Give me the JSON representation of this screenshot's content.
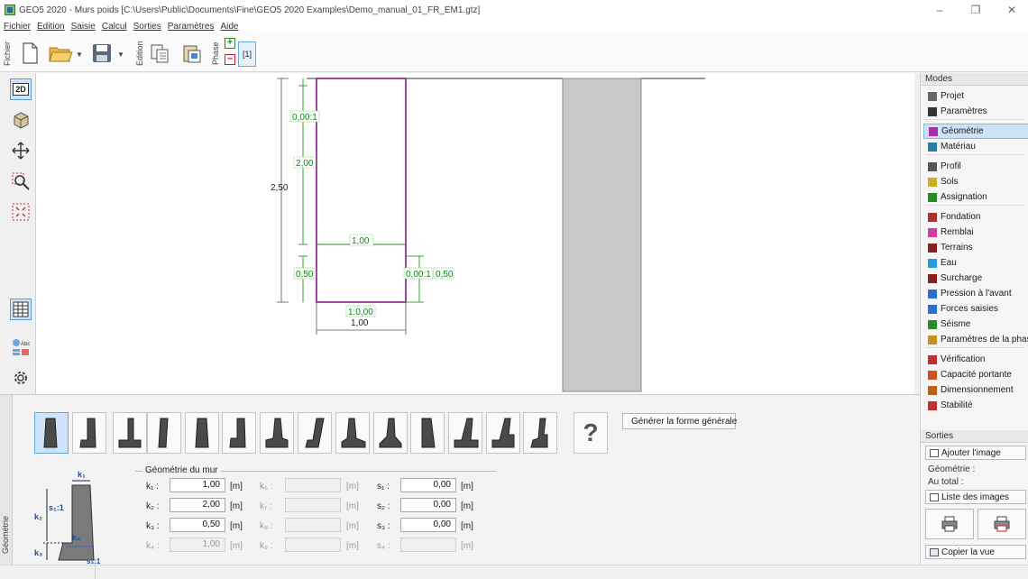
{
  "window": {
    "title": "GEO5 2020 - Murs poids [C:\\Users\\Public\\Documents\\Fine\\GEO5 2020 Examples\\Demo_manual_01_FR_EM1.gtz]",
    "minimize": "–",
    "maximize": "❐",
    "close": "✕"
  },
  "menu": [
    "Fichier",
    "Edition",
    "Saisie",
    "Calcul",
    "Sorties",
    "Paramètres",
    "Aide"
  ],
  "toolbar": {
    "fichier_label": "Fichier",
    "edition_label": "Edition",
    "phase_label": "Phase",
    "phase_tab": "[1]",
    "add_phase": "+",
    "remove_phase": "–"
  },
  "lefttools": {
    "btn_2d": "2D",
    "btn_3d": "3D"
  },
  "canvas": {
    "dims": {
      "top_slope": "0,00:1",
      "height_k2": "2,00",
      "height_total": "2,50",
      "width_k1": "1,00",
      "height_k3": "0,50",
      "toe_slope": "0,00:1",
      "height_k3_right": "0,50",
      "base_slope": "1:0,00",
      "base_width": "1,00"
    },
    "colors": {
      "wall_outline": "#8b1a8b",
      "dimension": "#0a8a0a",
      "terrain": "#c8c8c8"
    }
  },
  "modes": {
    "header": "Modes",
    "items": [
      {
        "label": "Projet",
        "icon": "project-icon"
      },
      {
        "label": "Paramètres",
        "icon": "settings-gear-icon"
      },
      {
        "label": "Géométrie",
        "icon": "geometry-icon",
        "active": true
      },
      {
        "label": "Matériau",
        "icon": "material-icon"
      },
      {
        "label": "Profil",
        "icon": "profile-icon"
      },
      {
        "label": "Sols",
        "icon": "soils-icon"
      },
      {
        "label": "Assignation",
        "icon": "assignment-icon"
      },
      {
        "label": "Fondation",
        "icon": "foundation-icon"
      },
      {
        "label": "Remblai",
        "icon": "backfill-icon"
      },
      {
        "label": "Terrains",
        "icon": "terrain-icon"
      },
      {
        "label": "Eau",
        "icon": "water-icon"
      },
      {
        "label": "Surcharge",
        "icon": "surcharge-icon"
      },
      {
        "label": "Pression à l'avant",
        "icon": "front-pressure-icon"
      },
      {
        "label": "Forces saisies",
        "icon": "applied-forces-icon"
      },
      {
        "label": "Séisme",
        "icon": "earthquake-icon"
      },
      {
        "label": "Paramètres de la phase",
        "icon": "stage-settings-icon"
      },
      {
        "label": "Vérification",
        "icon": "verification-icon"
      },
      {
        "label": "Capacité portante",
        "icon": "bearing-capacity-icon"
      },
      {
        "label": "Dimensionnement",
        "icon": "dimensioning-icon"
      },
      {
        "label": "Stabilité",
        "icon": "stability-icon"
      }
    ]
  },
  "outputs": {
    "header": "Sorties",
    "add_image": "Ajouter l'image",
    "geometry_label": "Géométrie :",
    "total_label": "Au total :",
    "image_list": "Liste des images",
    "copy_view": "Copier la vue"
  },
  "bottom": {
    "side_label": "Géométrie",
    "help": "?",
    "generate_button": "Générer la forme générale",
    "form_title": "Géométrie du mur",
    "fields": {
      "k1": {
        "label": "k₁ :",
        "value": "1,00",
        "unit": "[m]"
      },
      "k2": {
        "label": "k₂ :",
        "value": "2,00",
        "unit": "[m]"
      },
      "k3": {
        "label": "k₃ :",
        "value": "0,50",
        "unit": "[m]"
      },
      "k4": {
        "label": "k₄ :",
        "value": "1,00",
        "unit": "[m]"
      },
      "k6": {
        "label": "k₆ :",
        "value": "",
        "unit": "[m]"
      },
      "k7": {
        "label": "k₇ :",
        "value": "",
        "unit": "[m]"
      },
      "k8": {
        "label": "k₈ :",
        "value": "",
        "unit": "[m]"
      },
      "k9": {
        "label": "k₉ :",
        "value": "",
        "unit": "[m]"
      },
      "s1": {
        "label": "s₁ :",
        "value": "0,00",
        "unit": "[m]"
      },
      "s2": {
        "label": "s₂ :",
        "value": "0,00",
        "unit": "[m]"
      },
      "s3": {
        "label": "s₃ :",
        "value": "0,00",
        "unit": "[m]"
      },
      "s4": {
        "label": "s₄ :",
        "value": "",
        "unit": "[m]"
      }
    },
    "sketch_labels": {
      "k1": "k₁",
      "k2": "k₂",
      "k3": "k₃",
      "k4": "k₄",
      "s1": "s₁:1",
      "s3": "s₃:1"
    }
  }
}
